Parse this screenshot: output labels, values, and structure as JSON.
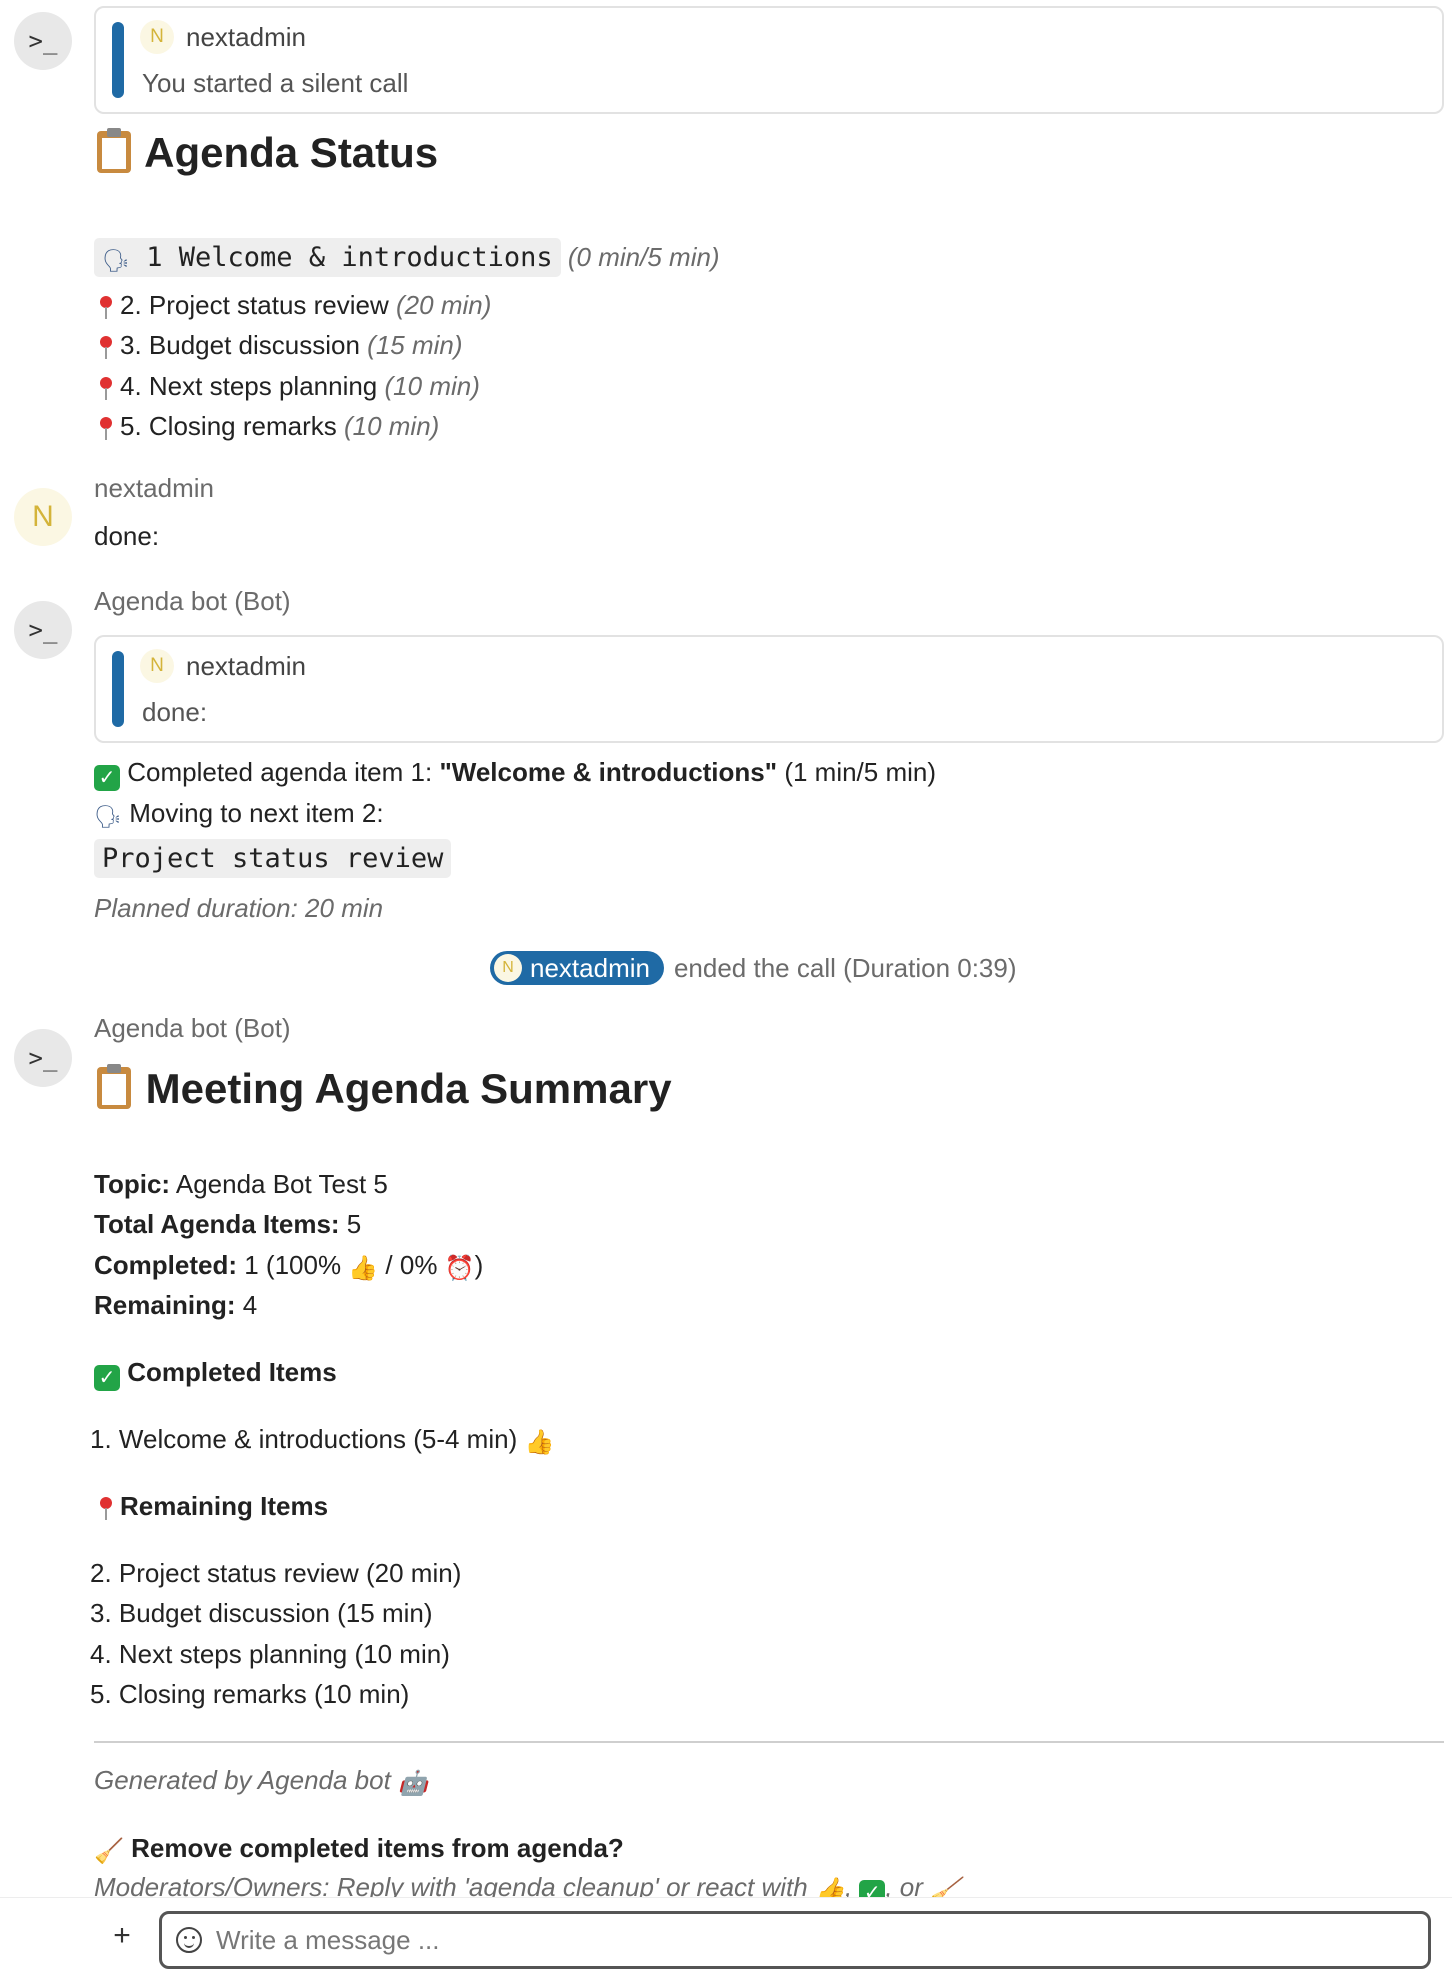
{
  "messages": {
    "m1": {
      "quote": {
        "avatar_letter": "N",
        "author": "nextadmin",
        "text": "You started a silent call"
      },
      "heading": "Agenda Status",
      "current_item": "1 Welcome & introductions",
      "current_time": "(0 min/5 min)",
      "items": [
        {
          "text": "2. Project status review",
          "time": "(20 min)"
        },
        {
          "text": "3. Budget discussion",
          "time": "(15 min)"
        },
        {
          "text": "4. Next steps planning",
          "time": "(10 min)"
        },
        {
          "text": "5. Closing remarks",
          "time": "(10 min)"
        }
      ]
    },
    "m2": {
      "avatar_letter": "N",
      "author": "nextadmin",
      "text": "done:"
    },
    "m3": {
      "author": "Agenda bot (Bot)",
      "quote": {
        "avatar_letter": "N",
        "author": "nextadmin",
        "text": "done:"
      },
      "completed_prefix": "Completed agenda item 1: ",
      "completed_name": "\"Welcome & introductions\"",
      "completed_time": " (1 min/5 min)",
      "moving_text": "Moving to next item 2:",
      "next_item": "Project status review",
      "planned": "Planned duration: 20 min"
    },
    "call_end": {
      "avatar_letter": "N",
      "user": "nextadmin",
      "text": "ended the call (Duration 0:39)"
    },
    "m4": {
      "author": "Agenda bot (Bot)",
      "heading": "Meeting Agenda Summary",
      "topic_label": "Topic:",
      "topic_value": " Agenda Bot Test 5",
      "total_label": "Total Agenda Items:",
      "total_value": " 5",
      "completed_label": "Completed:",
      "completed_value_a": " 1 (100% ",
      "completed_value_b": " / 0% ",
      "completed_value_c": ")",
      "remaining_label": "Remaining:",
      "remaining_value": " 4",
      "completed_section": "Completed Items",
      "completed_items": [
        "1. Welcome & introductions (5-4 min)"
      ],
      "remaining_section": "Remaining Items",
      "remaining_items": [
        "2. Project status review (20 min)",
        "3. Budget discussion (15 min)",
        "4. Next steps planning (10 min)",
        "5. Closing remarks (10 min)"
      ],
      "generated": "Generated by Agenda bot",
      "cleanup_question": "Remove completed items from agenda?",
      "cleanup_hint_a": "Moderators/Owners: Reply with 'agenda cleanup' or react with ",
      "cleanup_hint_b": ", ",
      "cleanup_hint_c": ", or "
    }
  },
  "icons": {
    "bot_avatar": ">_",
    "speaking": "🗣",
    "check": "✓",
    "thumbs_up": "👍",
    "alarm_clock": "⏰",
    "robot": "🤖",
    "broom": "🧹",
    "plus": "+"
  },
  "composer": {
    "placeholder": "Write a message ..."
  },
  "colors": {
    "accent": "#1f6aa5",
    "check_green": "#22a447",
    "pin_red": "#e03131"
  }
}
